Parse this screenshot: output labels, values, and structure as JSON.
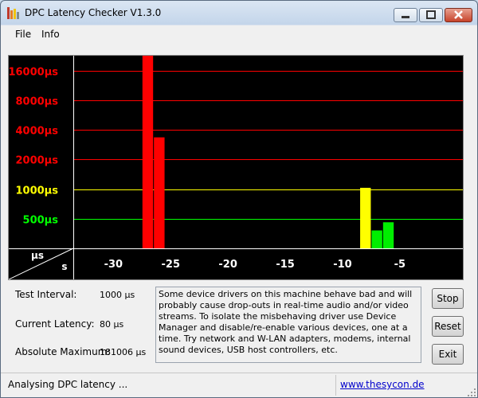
{
  "app": {
    "title": "DPC Latency Checker V1.3.0",
    "icon": "bar-chart-app-icon"
  },
  "menu": {
    "items": [
      "File",
      "Info"
    ]
  },
  "chart_data": {
    "type": "bar",
    "title": "",
    "xlabel": "s",
    "ylabel": "µs",
    "y_scale": "log2",
    "y_ticks": [
      {
        "label": "500µs",
        "value": 500,
        "color": "#00ff00"
      },
      {
        "label": "1000µs",
        "value": 1000,
        "color": "#ffff00"
      },
      {
        "label": "2000µs",
        "value": 2000,
        "color": "#ff0000"
      },
      {
        "label": "4000µs",
        "value": 4000,
        "color": "#ff0000"
      },
      {
        "label": "8000µs",
        "value": 8000,
        "color": "#ff0000"
      },
      {
        "label": "16000µs",
        "value": 16000,
        "color": "#ff0000"
      }
    ],
    "x_ticks": [
      {
        "label": "-30",
        "value": -30
      },
      {
        "label": "-25",
        "value": -25
      },
      {
        "label": "-20",
        "value": -20
      },
      {
        "label": "-15",
        "value": -15
      },
      {
        "label": "-10",
        "value": -10
      },
      {
        "label": "-5",
        "value": -5
      }
    ],
    "x_range": [
      -33,
      0
    ],
    "y_range": [
      250,
      22600
    ],
    "grid": true,
    "color_rule": {
      "below_1000": "#00ee00",
      "at_1000_to_2000": "#ffff00",
      "above_2000": "#ff0000"
    },
    "x": [
      -33,
      -32,
      -31,
      -30,
      -29,
      -28,
      -27,
      -26,
      -25,
      -24,
      -23,
      -22,
      -21,
      -20,
      -19,
      -18,
      -17,
      -16,
      -15,
      -14,
      -13,
      -12,
      -11,
      -10,
      -9,
      -8,
      -7,
      -6,
      -5,
      -4,
      -3,
      -2,
      -1
    ],
    "values": [
      80,
      80,
      80,
      80,
      80,
      90,
      181006,
      3350,
      75,
      75,
      75,
      70,
      70,
      85,
      85,
      85,
      85,
      105,
      75,
      75,
      85,
      85,
      85,
      85,
      70,
      1030,
      380,
      460,
      80,
      80,
      80,
      80,
      85
    ]
  },
  "fields": {
    "test_interval": {
      "label": "Test Interval:",
      "value": "1000 µs"
    },
    "current_latency": {
      "label": "Current Latency:",
      "value": "80 µs"
    },
    "absolute_maximum": {
      "label": "Absolute Maximum:",
      "value": "181006 µs"
    }
  },
  "info_text": "Some device drivers on this machine behave bad and will probably cause drop-outs in real-time audio and/or video streams. To isolate the misbehaving driver use Device Manager and disable/re-enable various devices, one at a time. Try network and W-LAN adapters, modems, internal sound devices, USB host controllers, etc.",
  "buttons": {
    "stop": "Stop",
    "reset": "Reset",
    "exit": "Exit"
  },
  "status": {
    "text": "Analysing DPC latency ...",
    "link": "www.thesycon.de"
  }
}
